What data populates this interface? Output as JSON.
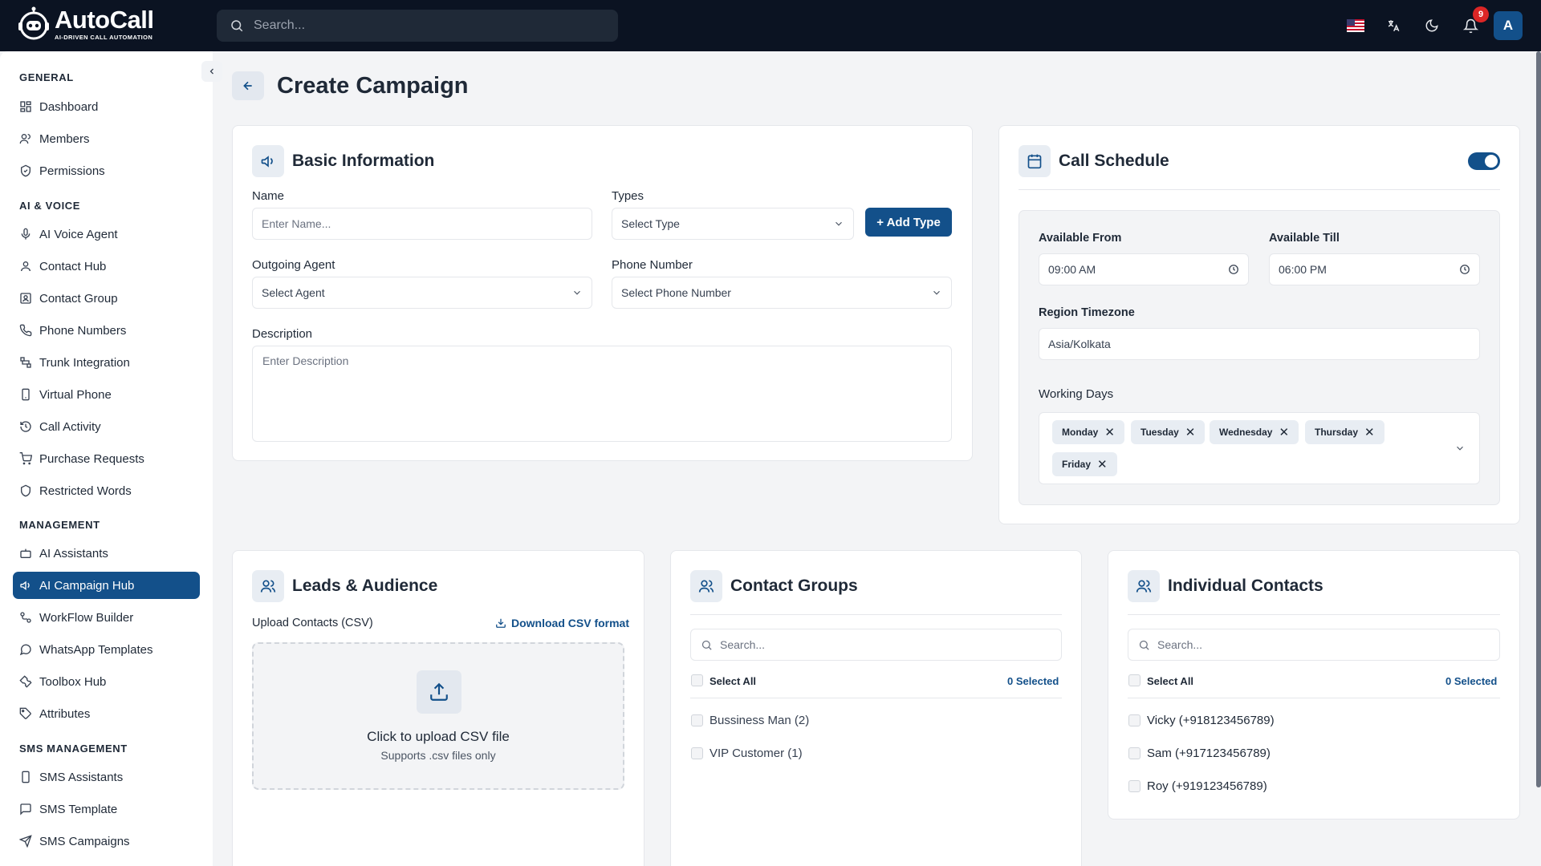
{
  "app": {
    "logo_title": "AutoCall",
    "logo_subtitle": "AI-DRIVEN CALL AUTOMATION",
    "search_placeholder": "Search...",
    "notification_count": "9",
    "avatar_initial": "A"
  },
  "sidebar": {
    "sections": [
      {
        "title": "GENERAL",
        "items": [
          "Dashboard",
          "Members",
          "Permissions"
        ]
      },
      {
        "title": "AI & VOICE",
        "items": [
          "AI Voice Agent",
          "Contact Hub",
          "Contact Group",
          "Phone Numbers",
          "Trunk Integration",
          "Virtual Phone",
          "Call Activity",
          "Purchase Requests",
          "Restricted Words"
        ]
      },
      {
        "title": "MANAGEMENT",
        "items": [
          "AI Assistants",
          "AI Campaign Hub",
          "WorkFlow Builder",
          "WhatsApp Templates",
          "Toolbox Hub",
          "Attributes"
        ]
      },
      {
        "title": "SMS MANAGEMENT",
        "items": [
          "SMS Assistants",
          "SMS Template",
          "SMS Campaigns"
        ]
      }
    ],
    "active_item": "AI Campaign Hub"
  },
  "page": {
    "title": "Create Campaign"
  },
  "basic_info": {
    "title": "Basic Information",
    "name_label": "Name",
    "name_placeholder": "Enter Name...",
    "types_label": "Types",
    "types_value": "Select Type",
    "add_type_label": "+ Add Type",
    "agent_label": "Outgoing Agent",
    "agent_value": "Select Agent",
    "phone_label": "Phone Number",
    "phone_value": "Select Phone Number",
    "description_label": "Description",
    "description_placeholder": "Enter Description"
  },
  "schedule": {
    "title": "Call Schedule",
    "enabled": true,
    "from_label": "Available From",
    "from_value": "09:00 AM",
    "till_label": "Available Till",
    "till_value": "06:00 PM",
    "timezone_label": "Region Timezone",
    "timezone_value": "Asia/Kolkata",
    "days_label": "Working Days",
    "days": [
      "Monday",
      "Tuesday",
      "Wednesday",
      "Thursday",
      "Friday"
    ]
  },
  "leads": {
    "title": "Leads & Audience",
    "upload_label": "Upload Contacts (CSV)",
    "download_label": "Download CSV format",
    "upload_title": "Click to upload CSV file",
    "upload_sub": "Supports .csv files only"
  },
  "groups": {
    "title": "Contact Groups",
    "search_placeholder": "Search...",
    "select_all": "Select All",
    "selected": "0 Selected",
    "items": [
      "Bussiness Man (2)",
      "VIP Customer (1)"
    ]
  },
  "contacts": {
    "title": "Individual Contacts",
    "search_placeholder": "Search...",
    "select_all": "Select All",
    "selected": "0 Selected",
    "items": [
      "Vicky (+918123456789)",
      "Sam (+917123456789)",
      "Roy (+919123456789)"
    ]
  }
}
